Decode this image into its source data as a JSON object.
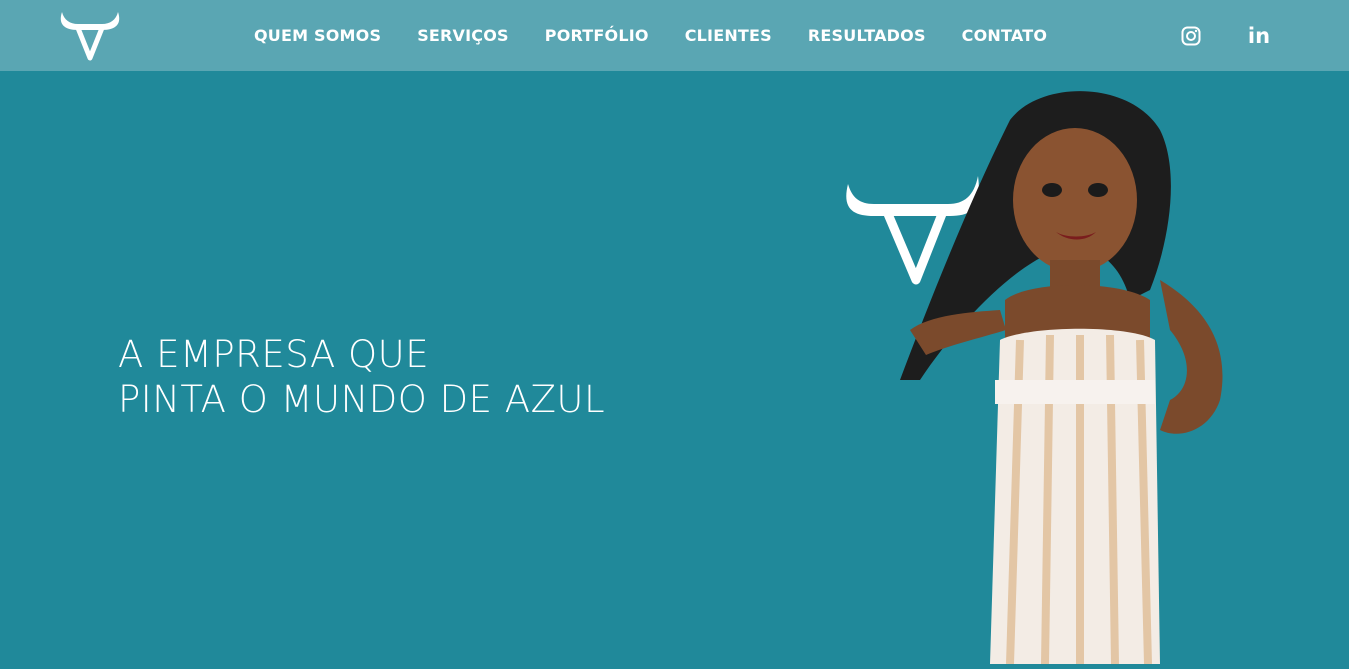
{
  "colors": {
    "background": "#20899a",
    "header": "#5aa6b3",
    "text": "#ffffff"
  },
  "header": {
    "logo_icon": "bull-horns-logo",
    "nav": [
      {
        "label": "QUEM SOMOS"
      },
      {
        "label": "SERVIÇOS"
      },
      {
        "label": "PORTFÓLIO"
      },
      {
        "label": "CLIENTES"
      },
      {
        "label": "RESULTADOS"
      },
      {
        "label": "CONTATO"
      }
    ],
    "social": {
      "instagram_icon": "instagram-icon",
      "linkedin_icon": "linkedin-icon",
      "linkedin_text": "in"
    }
  },
  "hero": {
    "line1": "A EMPRESA QUE",
    "line2": "PINTA O MUNDO DE AZUL"
  },
  "illustration": {
    "icon": "avatar-woman-with-bull-logo"
  }
}
